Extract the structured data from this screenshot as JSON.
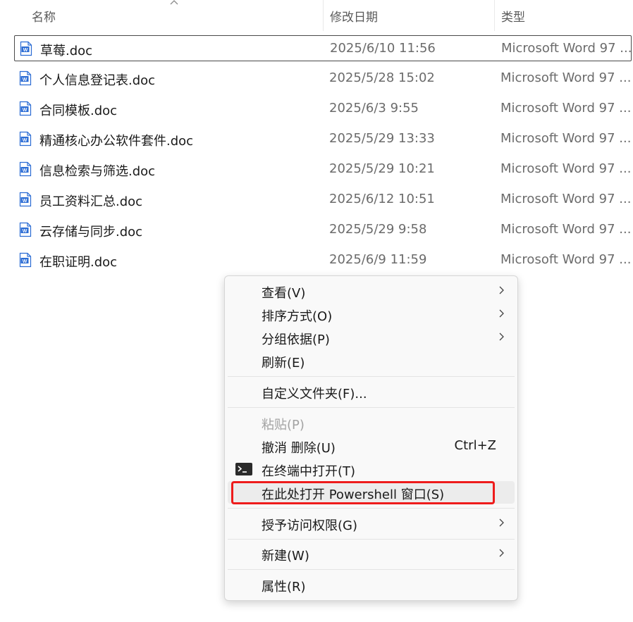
{
  "columns": {
    "name": "名称",
    "date": "修改日期",
    "type": "类型"
  },
  "files": [
    {
      "name": "草莓.doc",
      "date": "2025/6/10 11:56",
      "type": "Microsoft Word 97 ...",
      "icon": "word-doc-icon",
      "selected": true
    },
    {
      "name": "个人信息登记表.doc",
      "date": "2025/5/28 15:02",
      "type": "Microsoft Word 97 ...",
      "icon": "word-doc-icon"
    },
    {
      "name": "合同模板.doc",
      "date": "2025/6/3 9:55",
      "type": "Microsoft Word 97 ...",
      "icon": "word-doc-icon"
    },
    {
      "name": "精通核心办公软件套件.doc",
      "date": "2025/5/29 13:33",
      "type": "Microsoft Word 97 ...",
      "icon": "word-doc-icon"
    },
    {
      "name": "信息检索与筛选.doc",
      "date": "2025/5/29 10:21",
      "type": "Microsoft Word 97 ...",
      "icon": "word-doc-icon"
    },
    {
      "name": "员工资料汇总.doc",
      "date": "2025/6/12 10:51",
      "type": "Microsoft Word 97 ...",
      "icon": "word-doc-icon"
    },
    {
      "name": "云存储与同步.doc",
      "date": "2025/5/29 9:58",
      "type": "Microsoft Word 97 ...",
      "icon": "word-doc-icon"
    },
    {
      "name": "在职证明.doc",
      "date": "2025/6/9 11:59",
      "type": "Microsoft Word 97 ...",
      "icon": "word-doc-icon"
    }
  ],
  "context_menu": {
    "view": "查看(V)",
    "sort_by": "排序方式(O)",
    "group_by": "分组依据(P)",
    "refresh": "刷新(E)",
    "customize_folder": "自定义文件夹(F)...",
    "paste": "粘贴(P)",
    "undo_delete": "撤消 删除(U)",
    "undo_shortcut": "Ctrl+Z",
    "open_terminal": "在终端中打开(T)",
    "open_powershell": "在此处打开 Powershell 窗口(S)",
    "grant_access": "授予访问权限(G)",
    "new": "新建(W)",
    "properties": "属性(R)"
  },
  "colors": {
    "highlight_border": "#ee1c1c",
    "word_blue": "#2b6cd4",
    "menu_bg": "#f9f9f9",
    "selection_border": "#4a4a4a"
  }
}
